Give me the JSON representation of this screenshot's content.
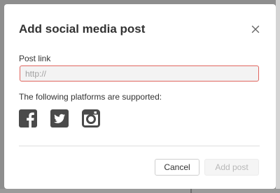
{
  "dialog": {
    "title": "Add social media post",
    "close_icon": "close-icon",
    "post_link_label": "Post link",
    "post_link_value": "",
    "post_link_placeholder": "http://",
    "supported_text": "The following platforms are supported:",
    "platforms": [
      {
        "icon": "facebook-icon"
      },
      {
        "icon": "twitter-icon"
      },
      {
        "icon": "instagram-icon"
      }
    ],
    "cancel_label": "Cancel",
    "add_label": "Add post",
    "add_enabled": false
  },
  "colors": {
    "backdrop": "#8e8e8e",
    "title_text": "#333333",
    "input_error_border": "#e0655e",
    "input_background": "#f3f3f3",
    "icon_color": "#4a4a4a",
    "disabled_button_text": "#b8b8b8"
  }
}
